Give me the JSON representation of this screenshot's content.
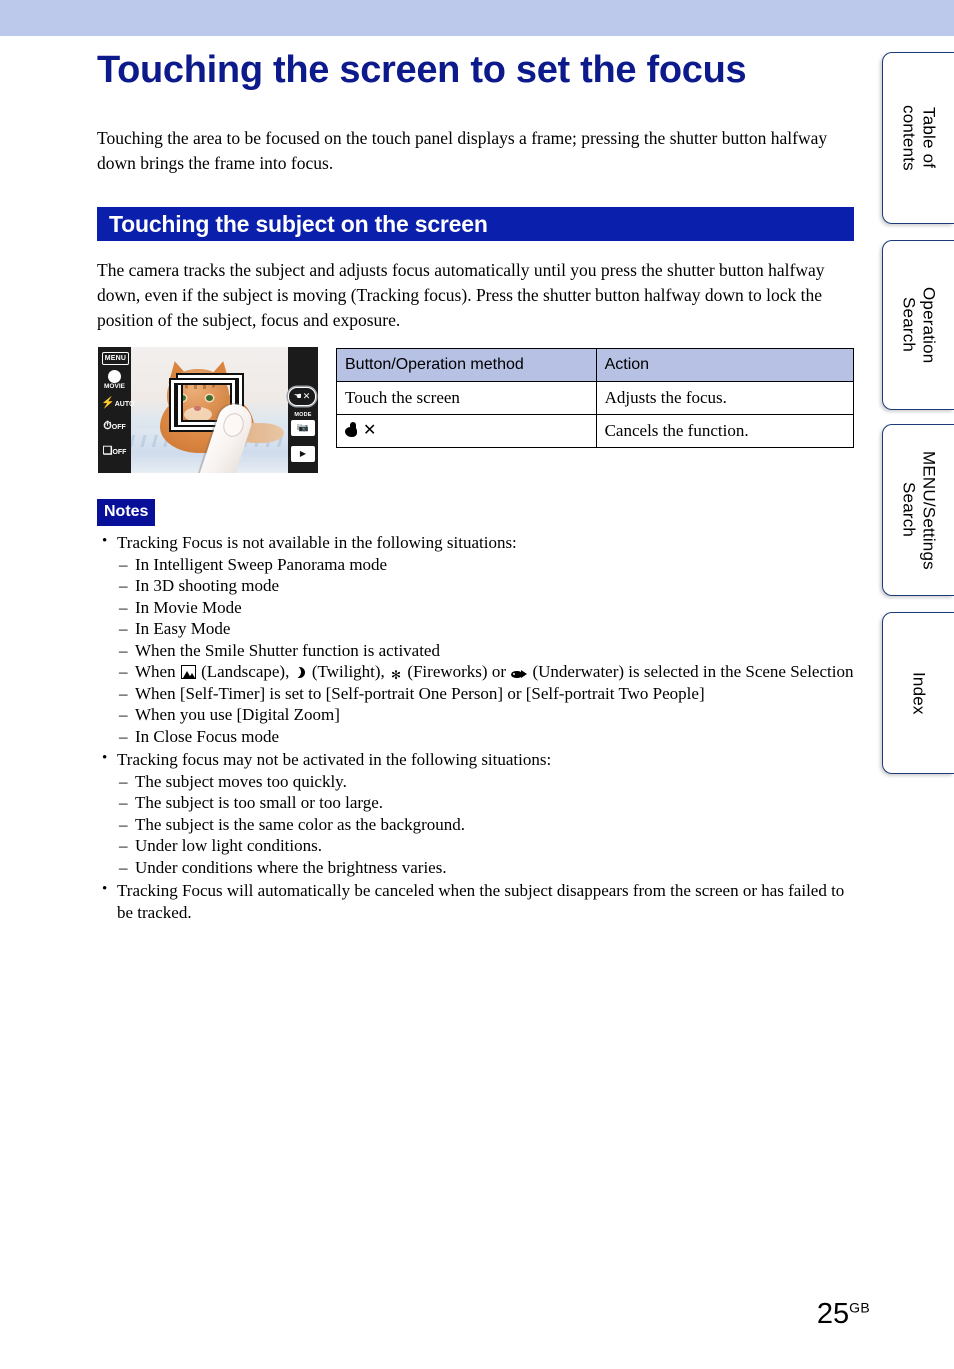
{
  "document": {
    "title": "Touching the screen to set the focus",
    "intro": "Touching the area to be focused on the touch panel displays a frame; pressing the shutter button halfway down brings the frame into focus.",
    "section_title": "Touching the subject on the screen",
    "section_body": "The camera tracks the subject and adjusts focus automatically until you press the shutter button halfway down, even if the subject is moving (Tracking focus). Press the shutter button halfway down to lock the position of the subject, focus and exposure."
  },
  "figure": {
    "name": "camera-lcd-tracking-focus",
    "left_icons": [
      {
        "name": "menu-icon",
        "label": "MENU"
      },
      {
        "name": "movie-mode-icon",
        "label": "MOVIE"
      },
      {
        "name": "flash-auto-icon",
        "label": "AUTO"
      },
      {
        "name": "self-timer-icon",
        "label": "OFF"
      },
      {
        "name": "burst-mode-icon",
        "label": "OFF"
      }
    ],
    "right_icons": [
      {
        "name": "cancel-tracking-icon",
        "label": "✕"
      },
      {
        "name": "shooting-mode-icon",
        "label": "MODE"
      },
      {
        "name": "playback-icon",
        "label": "▶"
      }
    ]
  },
  "table": {
    "headers": [
      "Button/Operation method",
      "Action"
    ],
    "rows": [
      {
        "method": "Touch the screen",
        "method_icon": null,
        "action": "Adjusts the focus."
      },
      {
        "method": "",
        "method_icon": "hand-cancel-icon",
        "action": "Cancels the function."
      }
    ]
  },
  "notes": {
    "badge": "Notes",
    "items": [
      {
        "text": "Tracking Focus is not available in the following situations:",
        "sub": [
          {
            "text": "In Intelligent Sweep Panorama mode"
          },
          {
            "text": "In 3D shooting mode"
          },
          {
            "text": "In Movie Mode"
          },
          {
            "text": "In Easy Mode"
          },
          {
            "text": "When the Smile Shutter function is activated"
          },
          {
            "rich": true,
            "prefix": "When ",
            "icon1": "landscape-icon",
            "mid1": " (Landscape), ",
            "icon2": "twilight-moon-icon",
            "mid2": " (Twilight), ",
            "icon3": "fireworks-icon",
            "mid3": " (Fireworks) or ",
            "icon4": "underwater-fish-icon",
            "suffix": " (Underwater) is selected in the Scene Selection"
          },
          {
            "text": "When [Self-Timer] is set to [Self-portrait One Person] or [Self-portrait Two People]"
          },
          {
            "text": "When you use [Digital Zoom]"
          },
          {
            "text": "In Close Focus mode"
          }
        ]
      },
      {
        "text": "Tracking focus may not be activated in the following situations:",
        "sub": [
          {
            "text": "The subject moves too quickly."
          },
          {
            "text": "The subject is too small or too large."
          },
          {
            "text": "The subject is the same color as the background."
          },
          {
            "text": "Under low light conditions."
          },
          {
            "text": "Under conditions where the brightness varies."
          }
        ]
      },
      {
        "text": "Tracking Focus will automatically be canceled when the subject disappears from the screen or has failed to be tracked.",
        "sub": []
      }
    ]
  },
  "side_tabs": [
    {
      "label": "Table of\ncontents"
    },
    {
      "label": "Operation\nSearch"
    },
    {
      "label": "MENU/Settings\nSearch"
    },
    {
      "label": "Index"
    }
  ],
  "footer": {
    "page_number": "25",
    "page_suffix": "GB"
  },
  "colors": {
    "band": "#bdc9ea",
    "title": "#0d1a8c",
    "section_bar": "#0a1fab",
    "notes_badge": "#080f99",
    "table_header": "#b6c1e4",
    "tab_border": "#1a3a7a"
  }
}
